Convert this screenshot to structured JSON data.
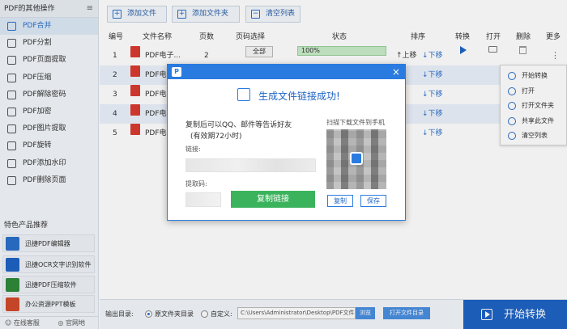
{
  "sidebar": {
    "header": "PDF的其他操作",
    "items": [
      {
        "label": "PDF合并",
        "active": true
      },
      {
        "label": "PDF分割"
      },
      {
        "label": "PDF页面提取"
      },
      {
        "label": "PDF压缩"
      },
      {
        "label": "PDF解除密码"
      },
      {
        "label": "PDF加密"
      },
      {
        "label": "PDF图片提取"
      },
      {
        "label": "PDF旋转"
      },
      {
        "label": "PDF添加水印"
      },
      {
        "label": "PDF删除页面"
      }
    ],
    "section_title": "特色产品推荐",
    "products": [
      {
        "label": "迅捷PDF编辑器",
        "color": "#2b6fc9"
      },
      {
        "label": "迅捷OCR文字识别软件",
        "color": "#1e63c4"
      },
      {
        "label": "迅捷PDF压缩软件",
        "color": "#2f8a3b"
      },
      {
        "label": "办公资源PPT模板",
        "color": "#d24a2c"
      }
    ],
    "footer": {
      "service": "在线客服",
      "website": "官网地址"
    }
  },
  "toolbar": {
    "add_file": "添加文件",
    "add_folder": "添加文件夹",
    "clear_list": "清空列表"
  },
  "table": {
    "headers": {
      "index": "编号",
      "name": "文件名称",
      "pages": "页数",
      "range": "页码选择",
      "status": "状态",
      "sort": "排序",
      "convert": "转换",
      "open": "打开",
      "delete": "删除",
      "more": "更多"
    },
    "rows": [
      {
        "index": "1",
        "name": "PDF电子...",
        "pages": "2",
        "range": "全部",
        "status": "100%",
        "up": "↑上移",
        "down": "↓下移"
      },
      {
        "index": "2",
        "name": "PDF电",
        "pages": "",
        "range": "",
        "status": "",
        "up": "",
        "down": "↓下移"
      },
      {
        "index": "3",
        "name": "PDF电",
        "pages": "",
        "range": "",
        "status": "",
        "up": "",
        "down": "↓下移"
      },
      {
        "index": "4",
        "name": "PDF电",
        "pages": "",
        "range": "",
        "status": "",
        "up": "",
        "down": "↓下移"
      },
      {
        "index": "5",
        "name": "PDF电",
        "pages": "",
        "range": "",
        "status": "",
        "up": "",
        "down": "↓下移"
      }
    ],
    "more_glyph": "⋮"
  },
  "context_menu": {
    "items": [
      "开始转换",
      "打开",
      "打开文件夹",
      "共享此文件",
      "清空列表"
    ]
  },
  "bottom": {
    "output_label": "输出目录:",
    "option_original": "原文件夹目录",
    "option_custom": "自定义:",
    "path": "C:\\Users\\Administrator\\Desktop\\PDF文件",
    "browse": "浏览",
    "open_folder": "打开文件目录",
    "start": "开始转换"
  },
  "modal": {
    "logo": "P",
    "close": "×",
    "title": "生成文件链接成功!",
    "instruction_line1": "复制后可以QQ、邮件等告诉好友",
    "instruction_line2": "(有效期72小时)",
    "link_label": "链接:",
    "code_label": "提取码:",
    "copy_link": "复制链接",
    "qr_caption": "扫描下载文件到手机",
    "copy": "复制",
    "save": "保存"
  }
}
